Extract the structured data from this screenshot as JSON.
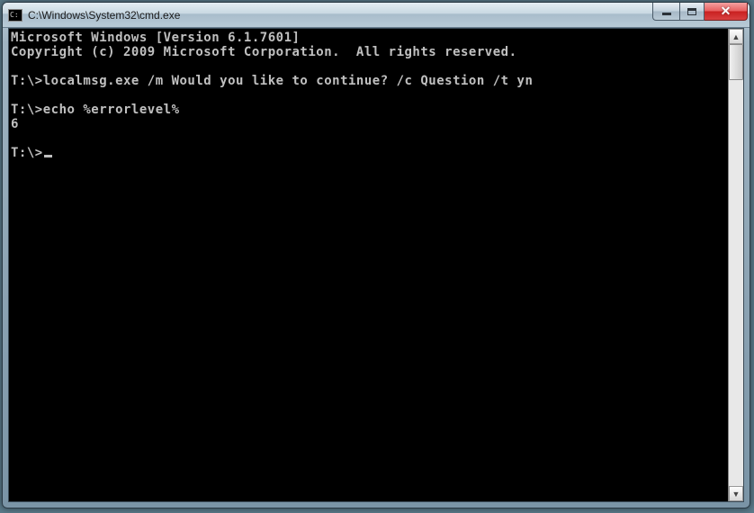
{
  "window": {
    "title": "C:\\Windows\\System32\\cmd.exe",
    "icon_label": "cmd-icon"
  },
  "terminal": {
    "lines": [
      "Microsoft Windows [Version 6.1.7601]",
      "Copyright (c) 2009 Microsoft Corporation.  All rights reserved.",
      "",
      "T:\\>localmsg.exe /m Would you like to continue? /c Question /t yn",
      "",
      "T:\\>echo %errorlevel%",
      "6",
      "",
      "T:\\>"
    ],
    "cursor_line_index": 8
  },
  "buttons": {
    "minimize": "minimize",
    "maximize": "maximize",
    "close": "close"
  }
}
